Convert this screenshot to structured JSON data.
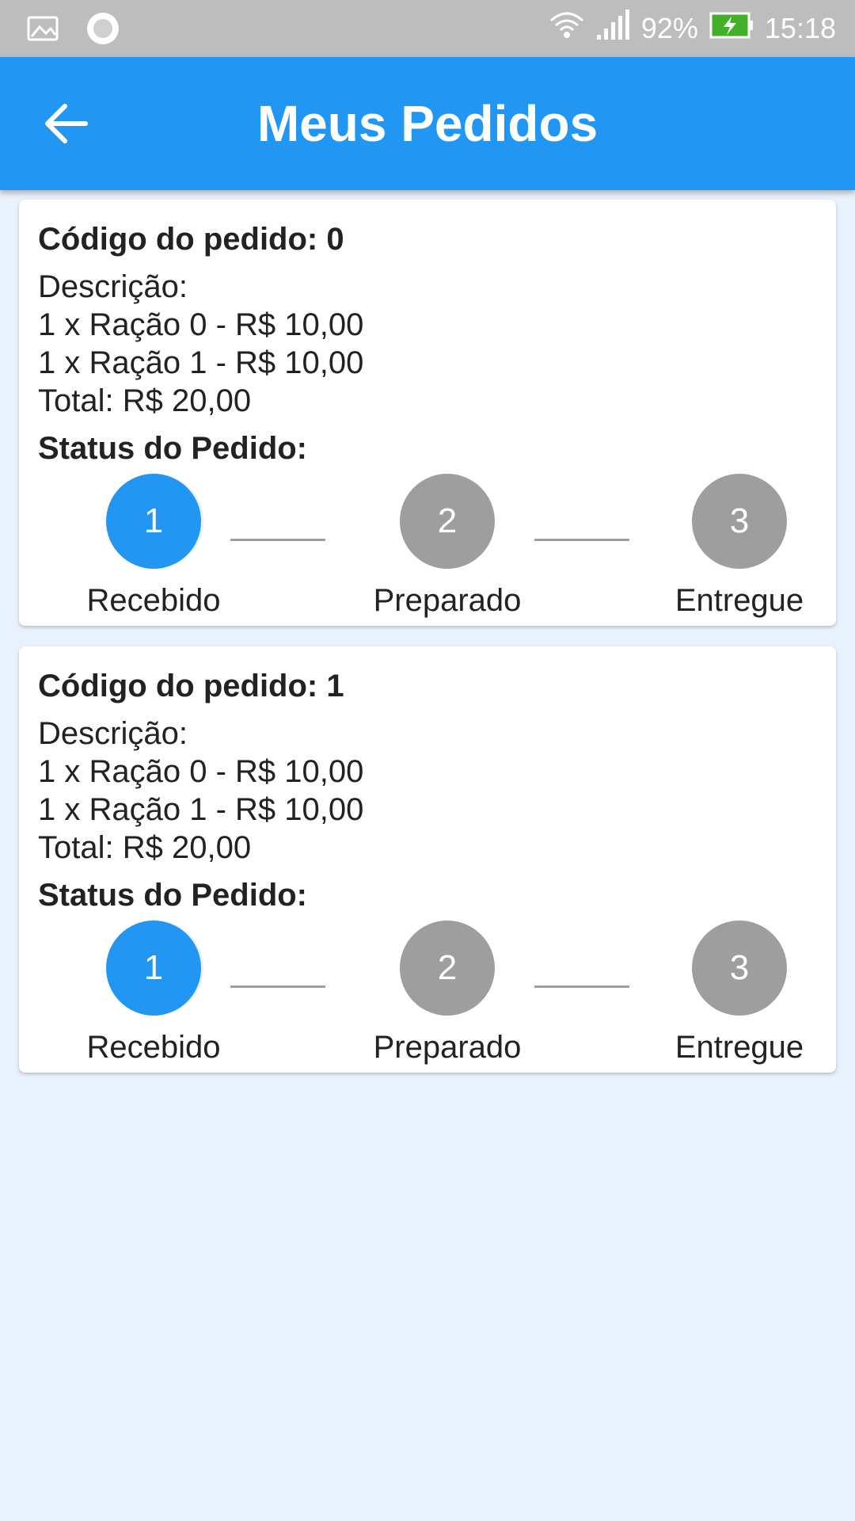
{
  "status_bar": {
    "battery": "92%",
    "time": "15:18",
    "icons": [
      "gallery-icon",
      "record-icon",
      "wifi-icon",
      "signal-icon",
      "battery-charging-icon"
    ]
  },
  "app_bar": {
    "title": "Meus Pedidos",
    "back_icon": "arrow-left-icon",
    "color": "#2196f3"
  },
  "orders": [
    {
      "code": "Código do pedido: 0",
      "description_label": "Descrição:",
      "items": [
        "1 x Ração 0 - R$ 10,00",
        "1 x Ração 1 - R$ 10,00"
      ],
      "total": "Total: R$ 20,00",
      "status_label": "Status do Pedido:",
      "steps": [
        {
          "number": "1",
          "label": "Recebido",
          "active": true
        },
        {
          "number": "2",
          "label": "Preparado",
          "active": false
        },
        {
          "number": "3",
          "label": "Entregue",
          "active": false
        }
      ]
    },
    {
      "code": "Código do pedido: 1",
      "description_label": "Descrição:",
      "items": [
        "1 x Ração 0 - R$ 10,00",
        "1 x Ração 1 - R$ 10,00"
      ],
      "total": "Total: R$ 20,00",
      "status_label": "Status do Pedido:",
      "steps": [
        {
          "number": "1",
          "label": "Recebido",
          "active": true
        },
        {
          "number": "2",
          "label": "Preparado",
          "active": false
        },
        {
          "number": "3",
          "label": "Entregue",
          "active": false
        }
      ]
    }
  ],
  "colors": {
    "active_step": "#2196f3",
    "inactive_step": "#9e9e9e",
    "background": "#e8f1fc"
  }
}
